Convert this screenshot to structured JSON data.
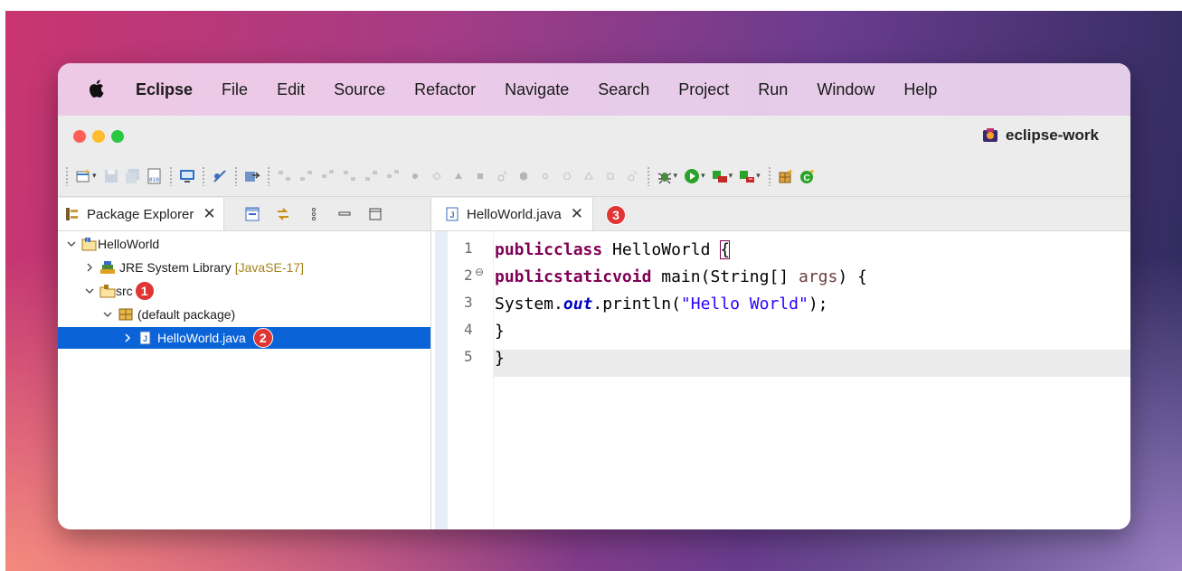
{
  "colors": {
    "selection": "#0b64d7",
    "keyword": "#7f0055",
    "string": "#2a00ff",
    "static_field": "#0000c0",
    "badge": "#e03535"
  },
  "menubar": {
    "apple_icon": "apple-logo-icon",
    "items": [
      "Eclipse",
      "File",
      "Edit",
      "Source",
      "Refactor",
      "Navigate",
      "Search",
      "Project",
      "Run",
      "Window",
      "Help"
    ]
  },
  "window": {
    "title": "eclipse-work"
  },
  "package_explorer": {
    "tab_label": "Package Explorer",
    "close_glyph": "✕",
    "tree": [
      {
        "label": "HelloWorld",
        "icon": "java-project-icon"
      },
      {
        "label": "JRE System Library",
        "suffix": "[JavaSE-17]",
        "icon": "library-icon"
      },
      {
        "label": "src",
        "icon": "source-folder-icon",
        "badge": "1"
      },
      {
        "label": "(default package)",
        "icon": "package-icon"
      },
      {
        "label": "HelloWorld.java",
        "icon": "java-file-icon",
        "badge": "2",
        "selected": true
      }
    ]
  },
  "editor": {
    "tab_label": "HelloWorld.java",
    "close_glyph": "✕",
    "tab_badge": "3",
    "line_numbers": [
      "1",
      "2",
      "3",
      "4",
      "5"
    ],
    "fold_marker": "⊖",
    "code": {
      "l1": {
        "kw1": "public",
        "kw2": "class",
        "name": " HelloWorld ",
        "brace": "{"
      },
      "l2": {
        "kw1": "public",
        "kw2": "static",
        "kw3": "void",
        "rest": " main(String[] ",
        "param": "args",
        "end": ") {"
      },
      "l3": {
        "pre": "System.",
        "field": "out",
        "mid": ".println(",
        "str": "\"Hello World\"",
        "end": ");"
      },
      "l4": {
        "text": "}"
      },
      "l5": {
        "text": "}"
      }
    }
  }
}
